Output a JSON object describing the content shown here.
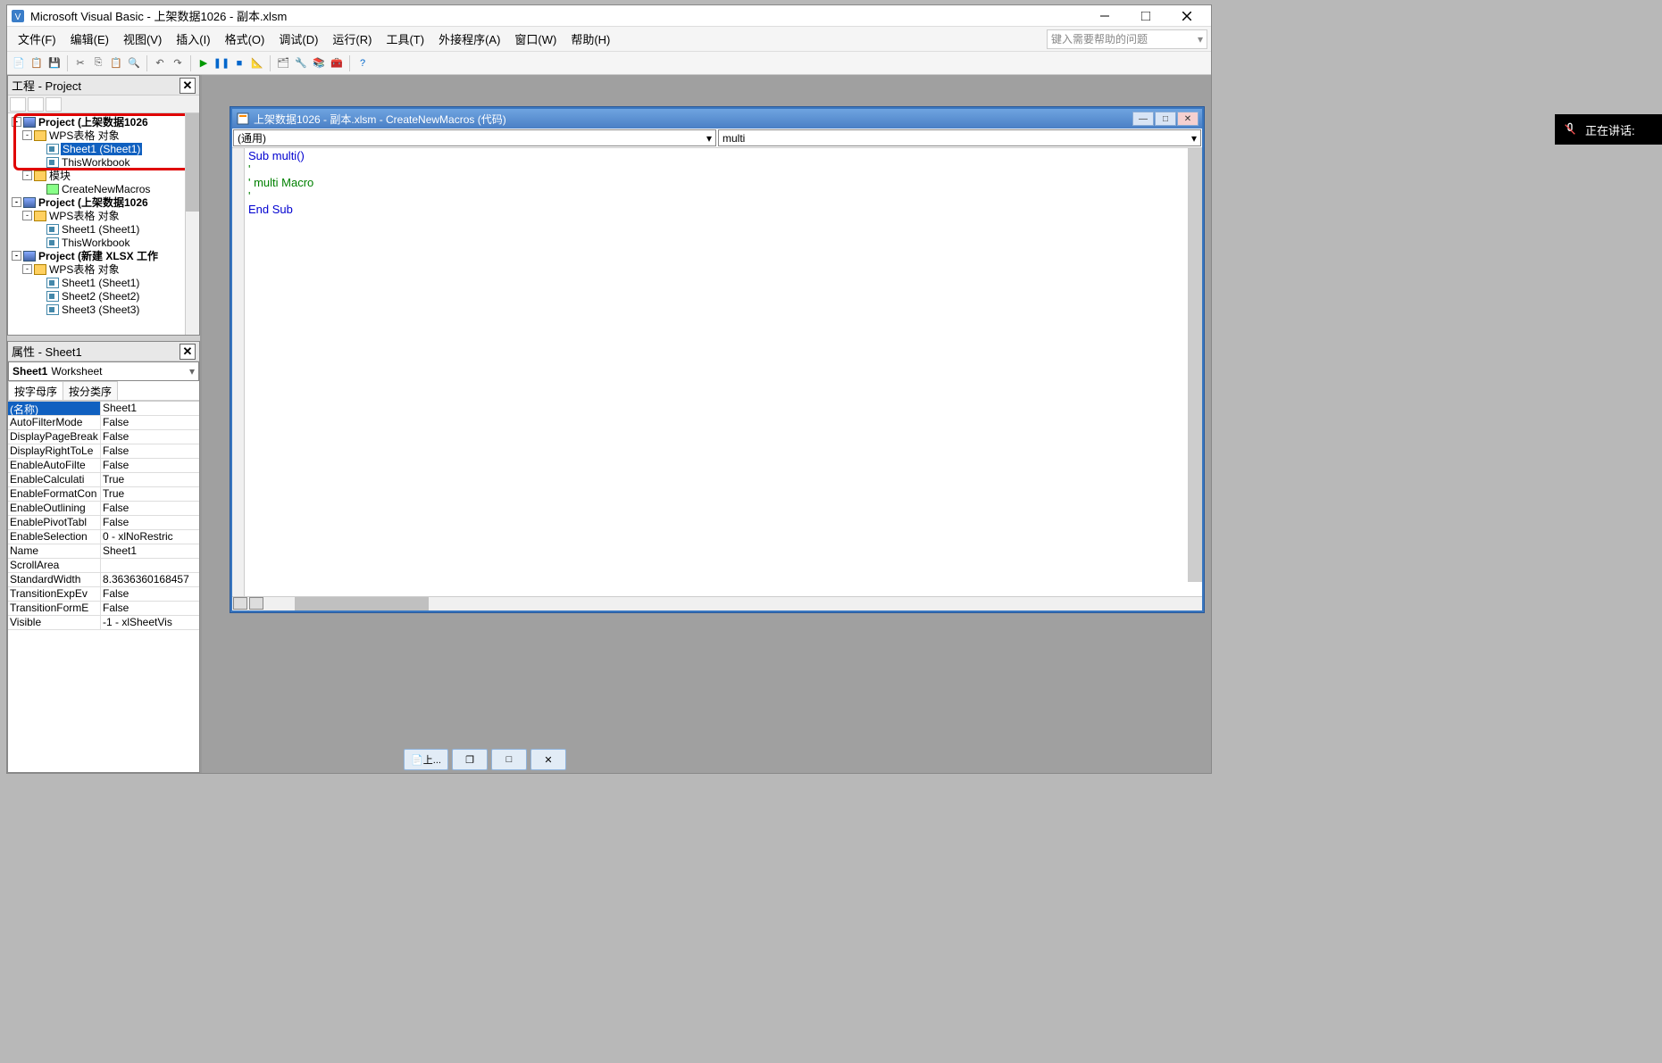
{
  "window": {
    "title": "Microsoft Visual Basic - 上架数据1026 - 副本.xlsm"
  },
  "menu": [
    "文件(F)",
    "编辑(E)",
    "视图(V)",
    "插入(I)",
    "格式(O)",
    "调试(D)",
    "运行(R)",
    "工具(T)",
    "外接程序(A)",
    "窗口(W)",
    "帮助(H)"
  ],
  "help_placeholder": "键入需要帮助的问题",
  "project_panel": {
    "title": "工程 - Project",
    "tree": [
      {
        "lvl": 0,
        "expand": "-",
        "icon": "proj",
        "label": "Project (上架数据1026",
        "bold": true
      },
      {
        "lvl": 1,
        "expand": "-",
        "icon": "folder",
        "label": "WPS表格 对象"
      },
      {
        "lvl": 2,
        "icon": "sheet",
        "label": "Sheet1 (Sheet1)",
        "selected": true
      },
      {
        "lvl": 2,
        "icon": "sheet",
        "label": "ThisWorkbook"
      },
      {
        "lvl": 1,
        "expand": "-",
        "icon": "folder",
        "label": "模块"
      },
      {
        "lvl": 2,
        "icon": "module",
        "label": "CreateNewMacros"
      },
      {
        "lvl": 0,
        "expand": "-",
        "icon": "proj",
        "label": "Project (上架数据1026",
        "bold": true
      },
      {
        "lvl": 1,
        "expand": "-",
        "icon": "folder",
        "label": "WPS表格 对象"
      },
      {
        "lvl": 2,
        "icon": "sheet",
        "label": "Sheet1 (Sheet1)"
      },
      {
        "lvl": 2,
        "icon": "sheet",
        "label": "ThisWorkbook"
      },
      {
        "lvl": 0,
        "expand": "-",
        "icon": "proj",
        "label": "Project (新建 XLSX 工作",
        "bold": true
      },
      {
        "lvl": 1,
        "expand": "-",
        "icon": "folder",
        "label": "WPS表格 对象"
      },
      {
        "lvl": 2,
        "icon": "sheet",
        "label": "Sheet1 (Sheet1)"
      },
      {
        "lvl": 2,
        "icon": "sheet",
        "label": "Sheet2 (Sheet2)"
      },
      {
        "lvl": 2,
        "icon": "sheet",
        "label": "Sheet3 (Sheet3)"
      }
    ]
  },
  "props_panel": {
    "title": "属性 - Sheet1",
    "combo_name": "Sheet1",
    "combo_type": "Worksheet",
    "tabs": [
      "按字母序",
      "按分类序"
    ],
    "rows": [
      {
        "name": "(名称)",
        "value": "Sheet1",
        "selected": true
      },
      {
        "name": "AutoFilterMode",
        "value": "False"
      },
      {
        "name": "DisplayPageBreak",
        "value": "False"
      },
      {
        "name": "DisplayRightToLe",
        "value": "False"
      },
      {
        "name": "EnableAutoFilte",
        "value": "False"
      },
      {
        "name": "EnableCalculati",
        "value": "True"
      },
      {
        "name": "EnableFormatCon",
        "value": "True"
      },
      {
        "name": "EnableOutlining",
        "value": "False"
      },
      {
        "name": "EnablePivotTabl",
        "value": "False"
      },
      {
        "name": "EnableSelection",
        "value": "0 - xlNoRestric"
      },
      {
        "name": "Name",
        "value": "Sheet1"
      },
      {
        "name": "ScrollArea",
        "value": ""
      },
      {
        "name": "StandardWidth",
        "value": "8.3636360168457"
      },
      {
        "name": "TransitionExpEv",
        "value": "False"
      },
      {
        "name": "TransitionFormE",
        "value": "False"
      },
      {
        "name": "Visible",
        "value": "-1 - xlSheetVis"
      }
    ]
  },
  "code_window": {
    "title": "上架数据1026 - 副本.xlsm - CreateNewMacros (代码)",
    "object_select": "(通用)",
    "proc_select": "multi",
    "lines": [
      {
        "t": "Sub multi()",
        "cls": "kw"
      },
      {
        "t": "'",
        "cls": "cm"
      },
      {
        "t": "' multi Macro",
        "cls": "cm"
      },
      {
        "t": "'",
        "cls": "cm"
      },
      {
        "t": "End Sub",
        "cls": "kw"
      }
    ]
  },
  "taskbar": {
    "item1": "上..."
  },
  "overlay": {
    "text": "正在讲话:"
  }
}
